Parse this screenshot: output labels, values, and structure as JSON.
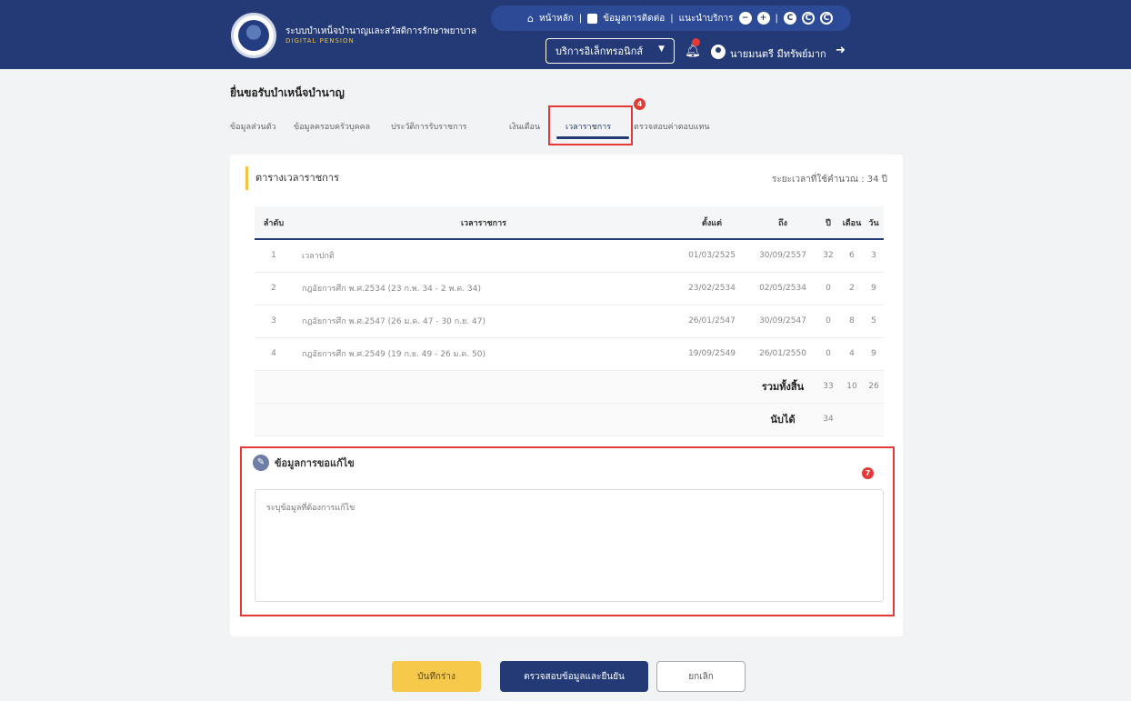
{
  "header": {
    "brand_th": "ระบบบำเหน็จบำนาญและสวัสดิการรักษาพยาบาล",
    "brand_en": "DIGITAL PENSION",
    "top_links": [
      "หน้าหลัก",
      "ข้อมูลการติดต่อ",
      "แนะนำบริการ"
    ],
    "service_select": "บริการอิเล็กทรอนิกส์",
    "user_name": "นายมนตรี มีทรัพย์มาก"
  },
  "page": {
    "title": "ยื่นขอรับบำเหน็จบำนาญ",
    "tabs": [
      "ข้อมูลส่วนตัว",
      "ข้อมูลครอบครัวบุคคล",
      "ประวัติการรับราชการ",
      "เงินเดือน",
      "เวลาราชการ",
      "ตรวจสอบค่าตอบแทน"
    ],
    "active_tab": "เวลาราชการ",
    "markers": [
      "4",
      "7"
    ]
  },
  "timeline": {
    "section_title": "ตารางเวลาราชการ",
    "total_service": "ระยะเวลาที่ใช้คำนวณ : 34 ปี",
    "headers": [
      "ลำดับ",
      "เวลาราชการ",
      "ตั้งแต่",
      "ถึง",
      "ปี",
      "เดือน",
      "วัน"
    ],
    "rows": [
      [
        "1",
        "เวลาปกติ",
        "01/03/2525",
        "30/09/2557",
        "32",
        "6",
        "3"
      ],
      [
        "2",
        "กฎอัยการศึก พ.ศ.2534 (23 ก.พ. 34 - 2 พ.ค. 34)",
        "23/02/2534",
        "02/05/2534",
        "0",
        "2",
        "9"
      ],
      [
        "3",
        "กฎอัยการศึก พ.ศ.2547 (26 ม.ค. 47 - 30 ก.ย. 47)",
        "26/01/2547",
        "30/09/2547",
        "0",
        "8",
        "5"
      ],
      [
        "4",
        "กฎอัยการศึก พ.ศ.2549 (19 ก.ย. 49 - 26 ม.ค. 50)",
        "19/09/2549",
        "26/01/2550",
        "0",
        "4",
        "9"
      ]
    ],
    "sum_label": "รวมทั้งสิ้น",
    "sum_values": [
      "33",
      "10",
      "26"
    ],
    "count_label": "นับได้",
    "count_value": "34"
  },
  "note": {
    "title": "ข้อมูลการขอแก้ไข",
    "placeholder": "ระบุข้อมูลที่ต้องการแก้ไข"
  },
  "actions": {
    "save": "บันทึกร่าง",
    "check": "ตรวจสอบข้อมูลและยืนยัน",
    "cancel": "ยกเลิก"
  }
}
